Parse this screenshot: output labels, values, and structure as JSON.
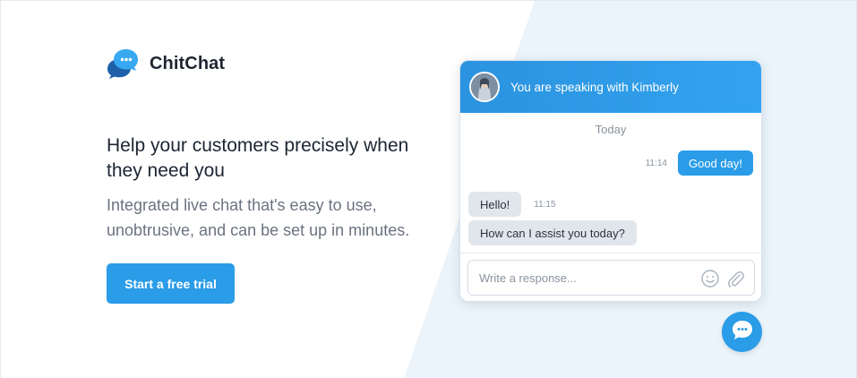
{
  "brand": {
    "name": "ChitChat",
    "logo_icon": "chat-bubbles-logo",
    "accent_color": "#2a9ce8"
  },
  "hero": {
    "headline": "Help your customers precisely when they need you",
    "subtext": "Integrated live chat that's easy to use, unobtrusive, and can be set up in minutes.",
    "cta_label": "Start a free trial"
  },
  "chat_widget": {
    "header_text": "You are speaking with Kimberly",
    "avatar_icon": "agent-avatar",
    "day_separator": "Today",
    "messages": [
      {
        "direction": "outgoing",
        "time": "11:14",
        "text": "Good day!"
      },
      {
        "direction": "incoming",
        "time": "11:15",
        "text": "Hello!"
      },
      {
        "direction": "incoming",
        "text": "How can I assist you today?"
      }
    ],
    "composer": {
      "placeholder": "Write a response...",
      "emoji_icon": "smiley-icon",
      "attach_icon": "paperclip-icon"
    },
    "launcher_icon": "chat-launcher-icon"
  }
}
